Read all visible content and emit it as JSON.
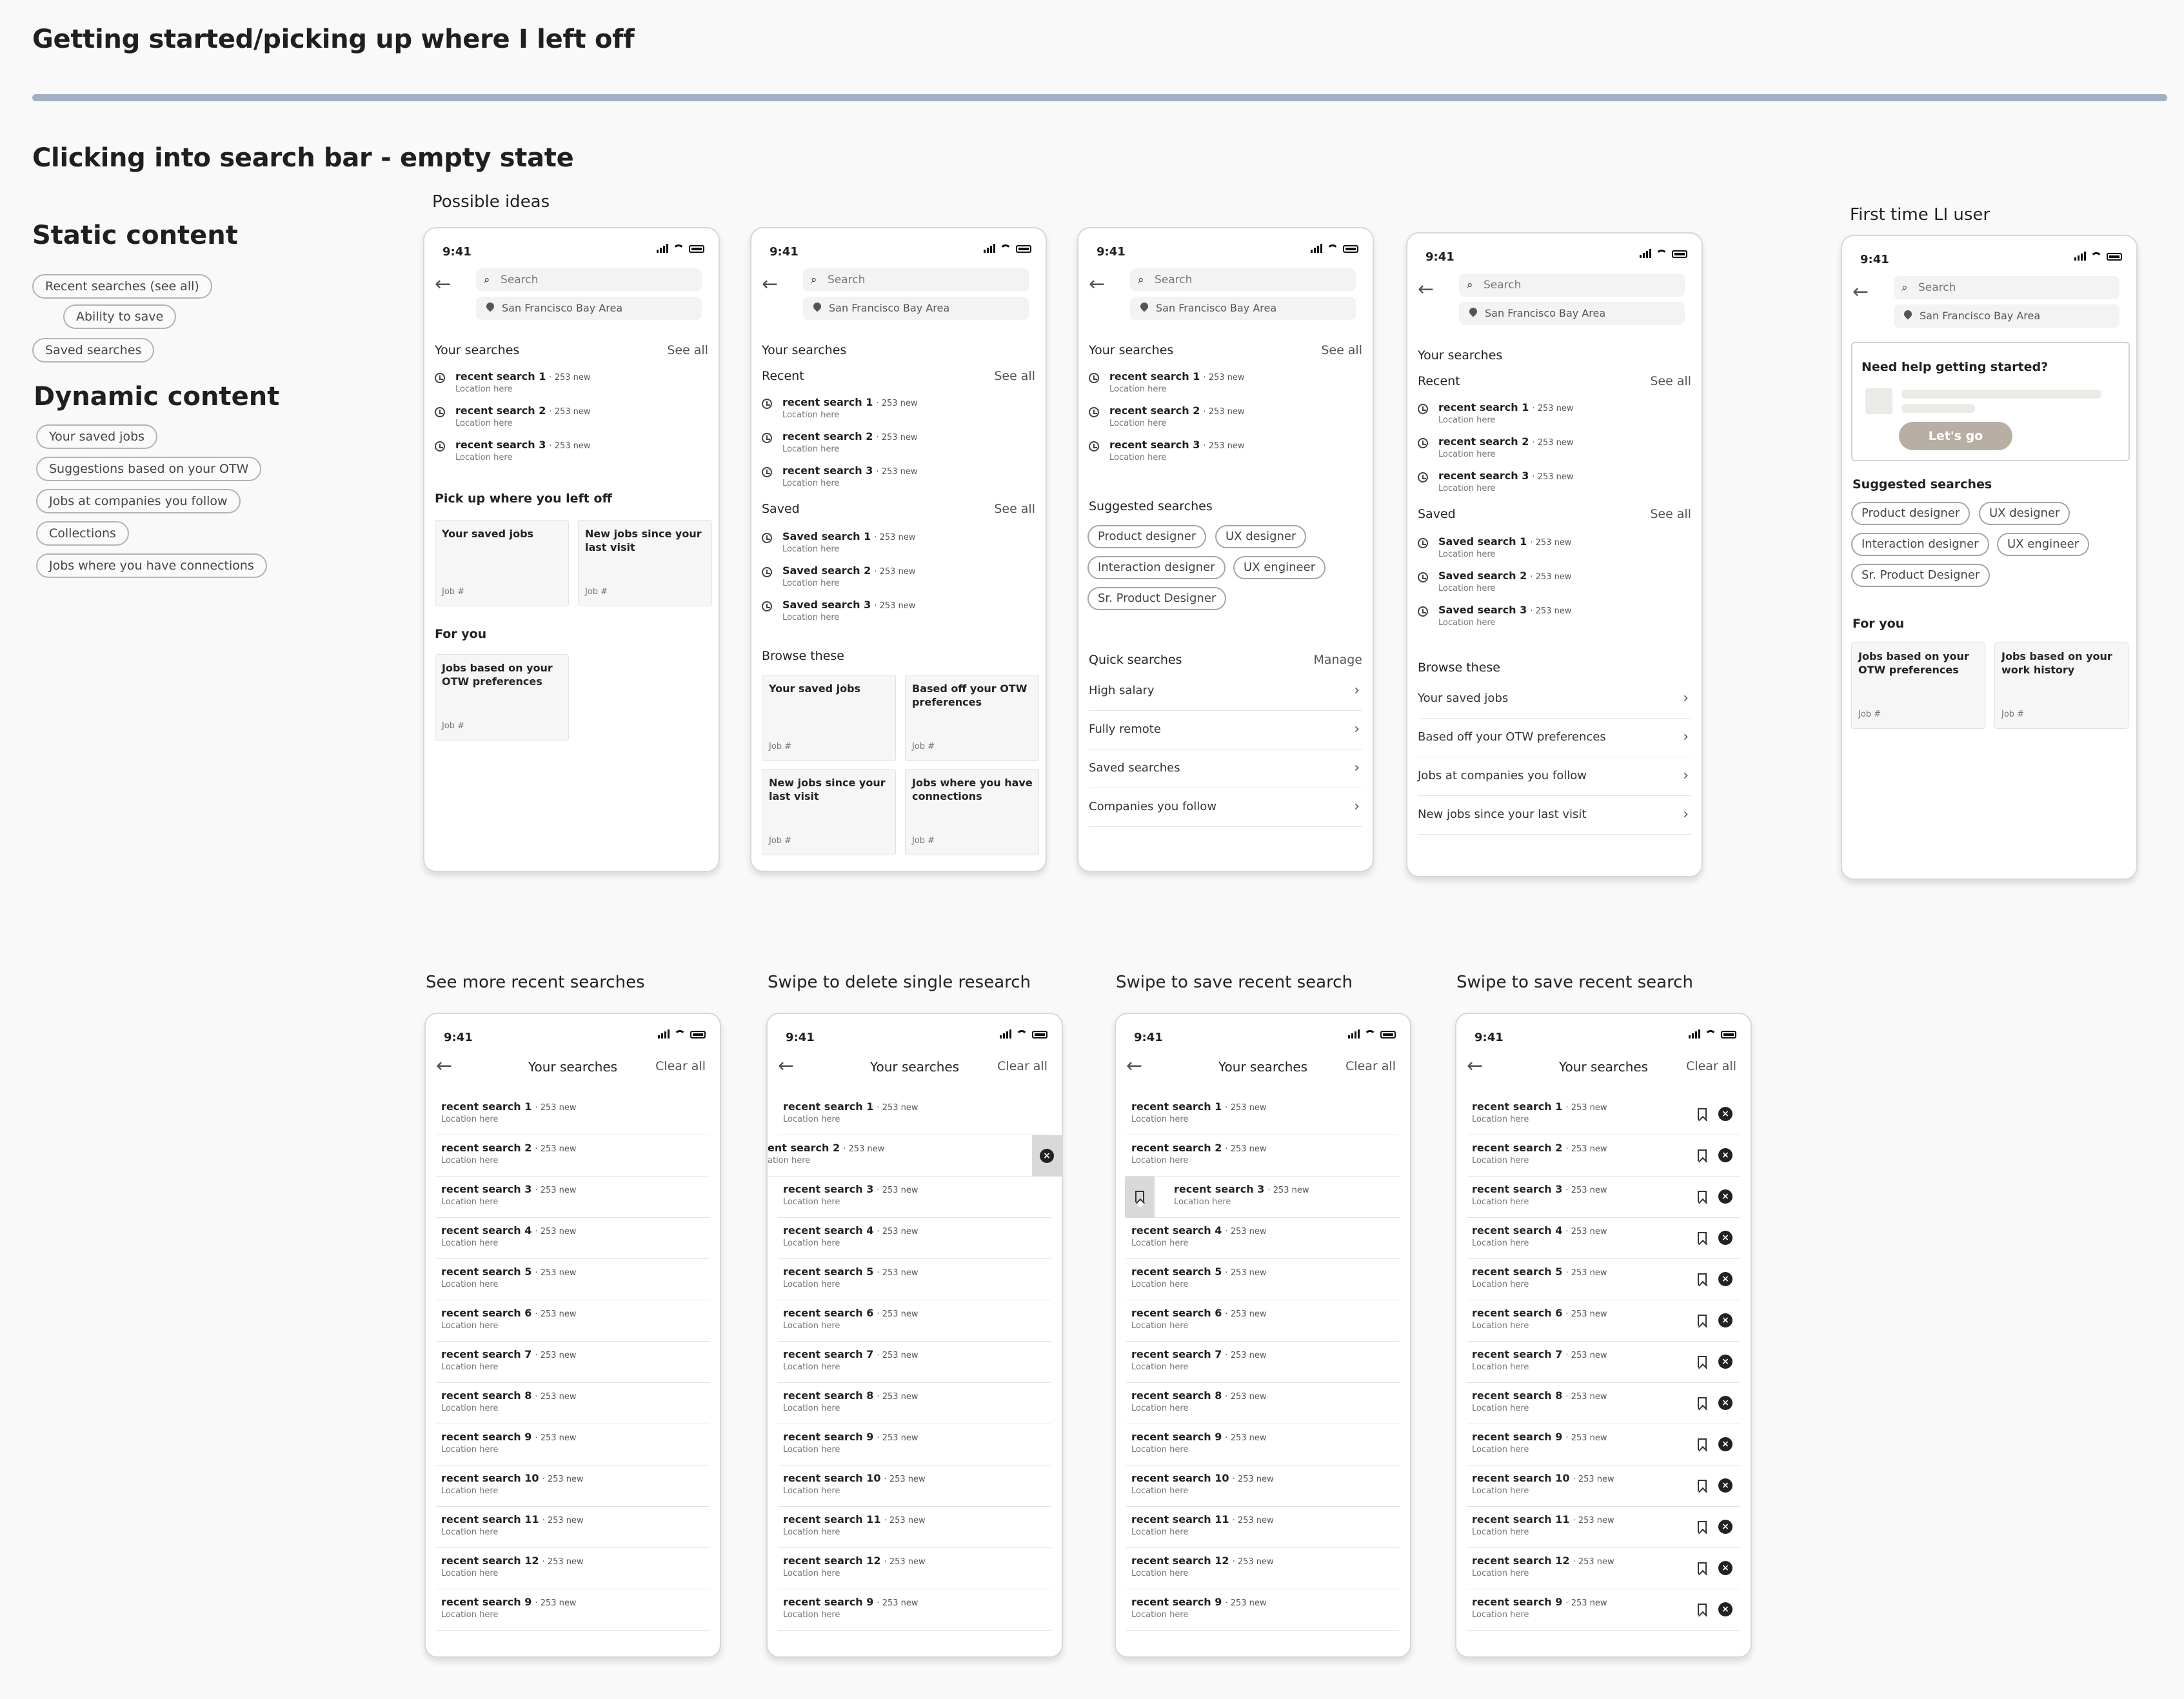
{
  "page_title": "Getting started/picking up where I left off",
  "section_title": "Clicking into search bar - empty state",
  "static_content": {
    "heading": "Static content",
    "tags": [
      "Recent searches (see all)",
      "Ability to save",
      "Saved searches"
    ]
  },
  "dynamic_content": {
    "heading": "Dynamic content",
    "tags": [
      "Your saved jobs",
      "Suggestions based on your OTW",
      "Jobs at companies you follow",
      "Collections",
      "Jobs where you have connections"
    ]
  },
  "labels": {
    "possible_ideas": "Possible ideas",
    "first_time": "First time LI user",
    "see_more": "See more recent searches",
    "swipe_delete": "Swipe to delete single research",
    "swipe_save1": "Swipe to save recent search",
    "swipe_save2": "Swipe to save recent search"
  },
  "common": {
    "time": "9:41",
    "search_placeholder": "Search",
    "location": "San Francisco Bay Area",
    "see_all": "See all",
    "manage": "Manage",
    "location_here": "Location here",
    "job_num": "Job #",
    "your_searches": "Your searches",
    "clear_all": "Clear all",
    "recent": "Recent",
    "saved": "Saved",
    "new_suffix": "253 new"
  },
  "recent": [
    "recent search 1",
    "recent search 2",
    "recent search 3"
  ],
  "saved_searches": [
    "Saved search 1",
    "Saved search 2",
    "Saved search 3"
  ],
  "phone1": {
    "pick_up": "Pick up where you left off",
    "card1": "Your saved jobs",
    "card2": "New jobs since your last visit",
    "for_you": "For you",
    "card3": "Jobs based on your OTW preferences"
  },
  "phone2": {
    "browse": "Browse these",
    "cards": [
      "Your saved jobs",
      "Based off your OTW preferences",
      "New jobs since your last visit",
      "Jobs where you have connections"
    ]
  },
  "phone3": {
    "suggested": "Suggested searches",
    "chips": [
      "Product designer",
      "UX designer",
      "Interaction designer",
      "UX engineer",
      "Sr. Product Designer"
    ],
    "quick": "Quick searches",
    "quick_items": [
      "High salary",
      "Fully remote",
      "Saved searches",
      "Companies you follow"
    ]
  },
  "phone4": {
    "browse": "Browse these",
    "items": [
      "Your saved jobs",
      "Based off your OTW preferences",
      "Jobs at companies you follow",
      "New jobs since your last visit"
    ]
  },
  "phone5": {
    "help_title": "Need help getting started?",
    "lets_go": "Let's go",
    "suggested": "Suggested searches",
    "chips": [
      "Product designer",
      "UX designer",
      "Interaction designer",
      "UX engineer",
      "Sr. Product Designer"
    ],
    "for_you": "For you",
    "card1": "Jobs based on your OTW preferences",
    "card2": "Jobs based on your work history"
  },
  "list": {
    "items": [
      "recent search 1",
      "recent search 2",
      "recent search 3",
      "recent search 4",
      "recent search 5",
      "recent search 6",
      "recent search 7",
      "recent search 8",
      "recent search 9",
      "recent search 10",
      "recent search 11",
      "recent search 12",
      "recent search 9"
    ],
    "swiped_delete_label": "ent search 2",
    "swiped_delete_loc": "ation here"
  }
}
